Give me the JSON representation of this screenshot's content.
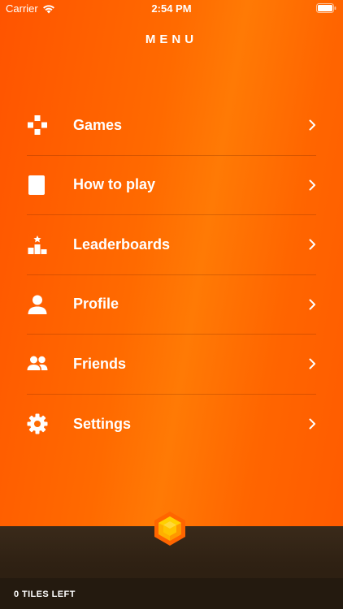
{
  "status_bar": {
    "carrier": "Carrier",
    "time": "2:54 PM"
  },
  "menu": {
    "title": "MENU",
    "items": [
      {
        "label": "Games",
        "icon": "gamepad-icon"
      },
      {
        "label": "How to play",
        "icon": "book-icon"
      },
      {
        "label": "Leaderboards",
        "icon": "podium-icon"
      },
      {
        "label": "Profile",
        "icon": "person-icon"
      },
      {
        "label": "Friends",
        "icon": "friends-icon"
      },
      {
        "label": "Settings",
        "icon": "gear-icon"
      }
    ]
  },
  "footer": {
    "tiles_left": "0 TILES LEFT"
  },
  "colors": {
    "accent_orange": "#ff6a00",
    "footer_brown": "#2f2113",
    "hex_yellow": "#ffc400"
  }
}
